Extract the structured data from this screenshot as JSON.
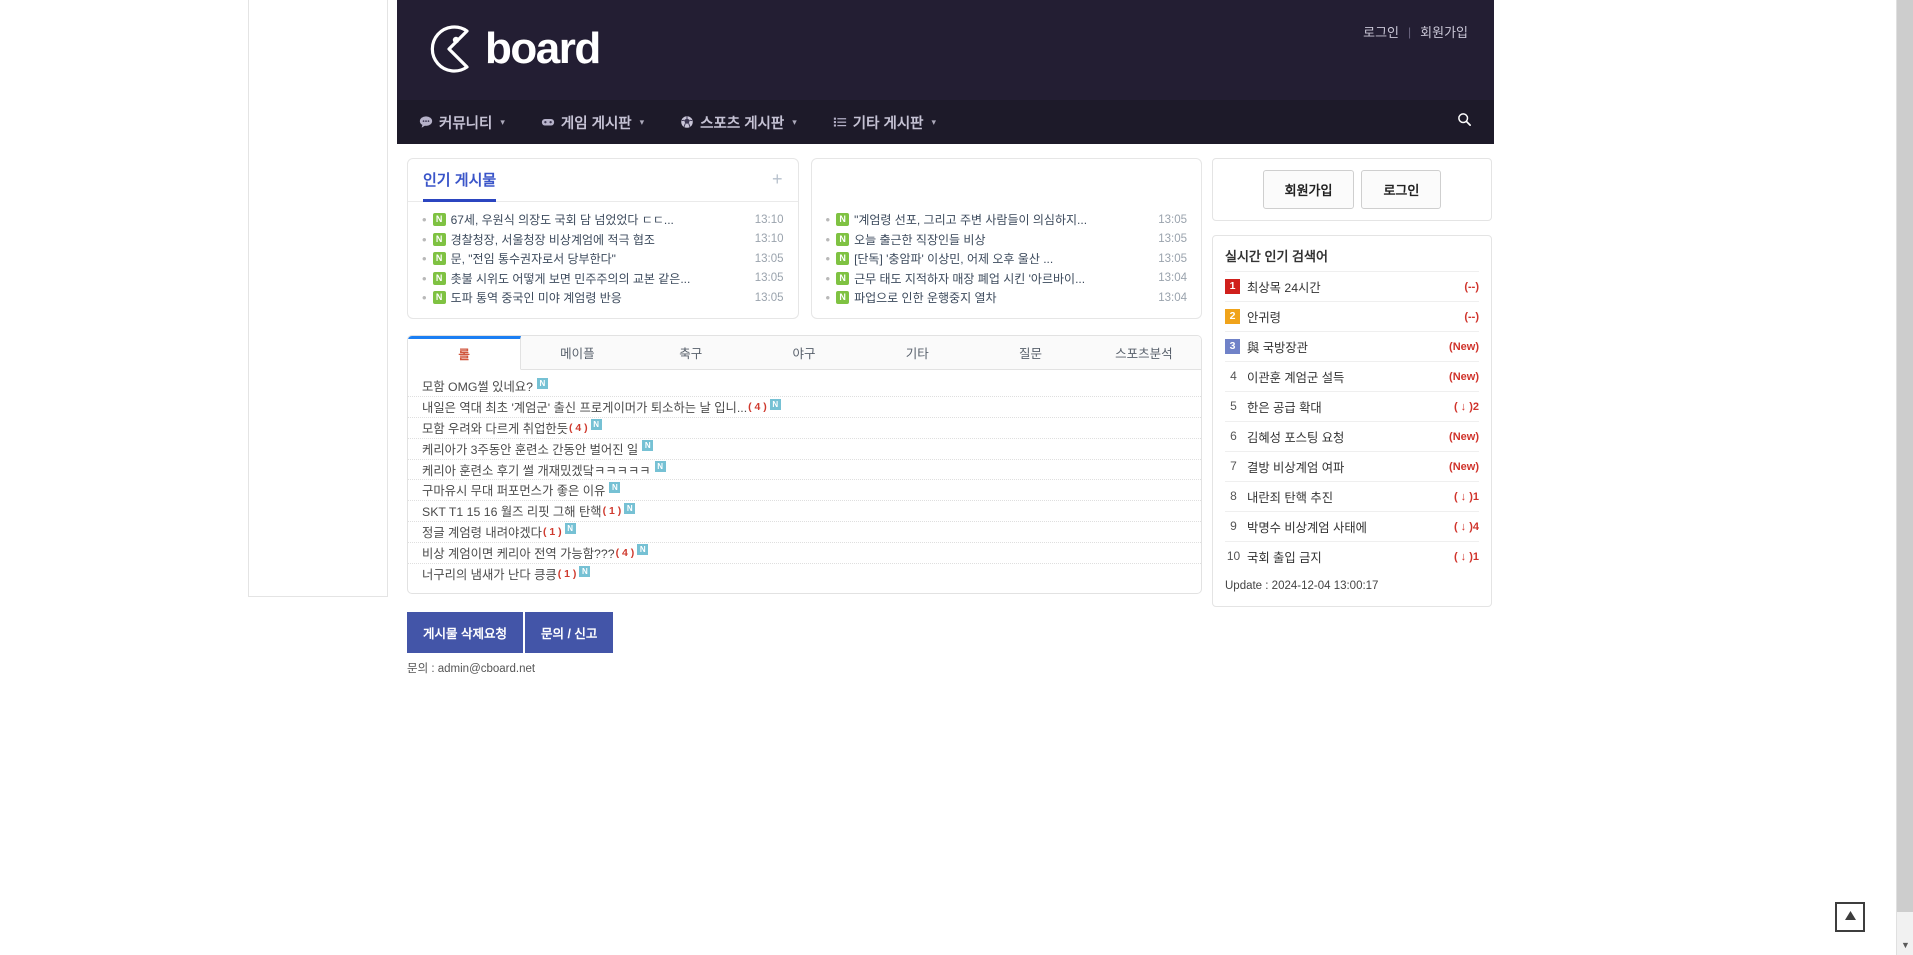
{
  "site": {
    "logo_text": "board",
    "logo_icon": "cboard-pacman-logo-icon"
  },
  "header": {
    "login_label": "로그인",
    "separator": "|",
    "signup_label": "회원가입"
  },
  "nav": {
    "items": [
      {
        "label": "커뮤니티",
        "icon": "speech-bubble-icon",
        "caret": "▾"
      },
      {
        "label": "게임 게시판",
        "icon": "game-controller-icon",
        "caret": "▾"
      },
      {
        "label": "스포츠 게시판",
        "icon": "soccer-ball-icon",
        "caret": "▾"
      },
      {
        "label": "기타 게시판",
        "icon": "list-icon",
        "caret": "▾"
      }
    ],
    "search_icon": "search-icon"
  },
  "popular_panel": {
    "title": "인기 게시물",
    "plus_label": "+",
    "badge": "N",
    "posts": [
      {
        "title": "67세, 우원식 의장도 국회 담 넘었었다 ㄷㄷ...",
        "time": "13:10"
      },
      {
        "title": "경찰청장, 서울청장 비상계엄에 적극 협조",
        "time": "13:10"
      },
      {
        "title": "문, \"전임 통수권자로서 당부한다\"",
        "time": "13:05"
      },
      {
        "title": "촛불 시위도 어떻게 보면 민주주의의 교본 같은...",
        "time": "13:05"
      },
      {
        "title": "도파 통역 중국인 미야 계엄령 반응",
        "time": "13:05"
      }
    ]
  },
  "secondary_panel": {
    "title": "",
    "badge": "N",
    "posts": [
      {
        "title": "\"계엄령 선포, 그리고 주변 사람들이 의심하지...",
        "time": "13:05"
      },
      {
        "title": "오늘 출근한 직장인들 비상",
        "time": "13:05"
      },
      {
        "title": "[단독] '충암파' 이상민, 어제 오후 울산 ...",
        "time": "13:05"
      },
      {
        "title": "근무 태도 지적하자 매장 폐업 시킨 '아르바이...",
        "time": "13:04"
      },
      {
        "title": "파업으로 인한 운행중지 열차",
        "time": "13:04"
      }
    ]
  },
  "board": {
    "tabs": [
      {
        "label": "롤",
        "active": true
      },
      {
        "label": "메이플",
        "active": false
      },
      {
        "label": "축구",
        "active": false
      },
      {
        "label": "야구",
        "active": false
      },
      {
        "label": "기타",
        "active": false
      },
      {
        "label": "질문",
        "active": false
      },
      {
        "label": "스포츠분석",
        "active": false
      }
    ],
    "new_badge": "N",
    "rows": [
      {
        "title": "모함 OMG썰 있네요?",
        "count": ""
      },
      {
        "title": "내일은 역대 최초 '계엄군' 출신 프로게이머가 퇴소하는 날 입니...",
        "count": "( 4 )"
      },
      {
        "title": "모함 우려와 다르게 취업한듯",
        "count": "( 4 )"
      },
      {
        "title": "케리아가 3주동안 훈련소 간동안 벌어진 일",
        "count": ""
      },
      {
        "title": "케리아 훈련소 후기 썰 개재밌겠닼ㅋㅋㅋㅋㅋ",
        "count": ""
      },
      {
        "title": "구마유시 무대 퍼포먼스가 좋은 이유",
        "count": ""
      },
      {
        "title": "SKT T1 15 16 월즈 리핏 그해 탄핵",
        "count": "( 1 )"
      },
      {
        "title": "정글 계엄령 내려야겠다",
        "count": "( 1 )"
      },
      {
        "title": "비상 계엄이면 케리아 전역 가능함???",
        "count": "( 4 )"
      },
      {
        "title": "너구리의 냄새가 난다 킁킁",
        "count": "( 1 )"
      }
    ]
  },
  "footer": {
    "delete_request_label": "게시물 삭제요청",
    "report_label": "문의 / 신고",
    "contact": "문의 : admin@cboard.net"
  },
  "sidebar": {
    "signup_label": "회원가입",
    "login_label": "로그인",
    "rank_title": "실시간 인기 검색어",
    "rankings": [
      {
        "no": "1",
        "keyword": "최상목 24시간",
        "change": "(--)",
        "color": "#d0201c"
      },
      {
        "no": "2",
        "keyword": "안귀령",
        "change": "(--)",
        "color": "#f0a31a"
      },
      {
        "no": "3",
        "keyword": "與 국방장관",
        "change": "(New)",
        "color": "#7082c8"
      },
      {
        "no": "4",
        "keyword": "이관훈 계엄군 설득",
        "change": "(New)",
        "color": ""
      },
      {
        "no": "5",
        "keyword": "한은 공급 확대",
        "change": "( ↓ )2",
        "color": ""
      },
      {
        "no": "6",
        "keyword": "김혜성 포스팅 요청",
        "change": "(New)",
        "color": ""
      },
      {
        "no": "7",
        "keyword": "결방 비상계엄 여파",
        "change": "(New)",
        "color": ""
      },
      {
        "no": "8",
        "keyword": "내란죄 탄핵 추진",
        "change": "( ↓ )1",
        "color": ""
      },
      {
        "no": "9",
        "keyword": "박명수 비상계엄 사태에",
        "change": "( ↓ )4",
        "color": ""
      },
      {
        "no": "10",
        "keyword": "국회 출입 금지",
        "change": "( ↓ )1",
        "color": ""
      }
    ],
    "update_text": "Update : 2024-12-04 13:00:17"
  },
  "controls": {
    "to_top_icon": "triangle-up-icon",
    "scroll_down_icon": "chevron-down-icon"
  }
}
